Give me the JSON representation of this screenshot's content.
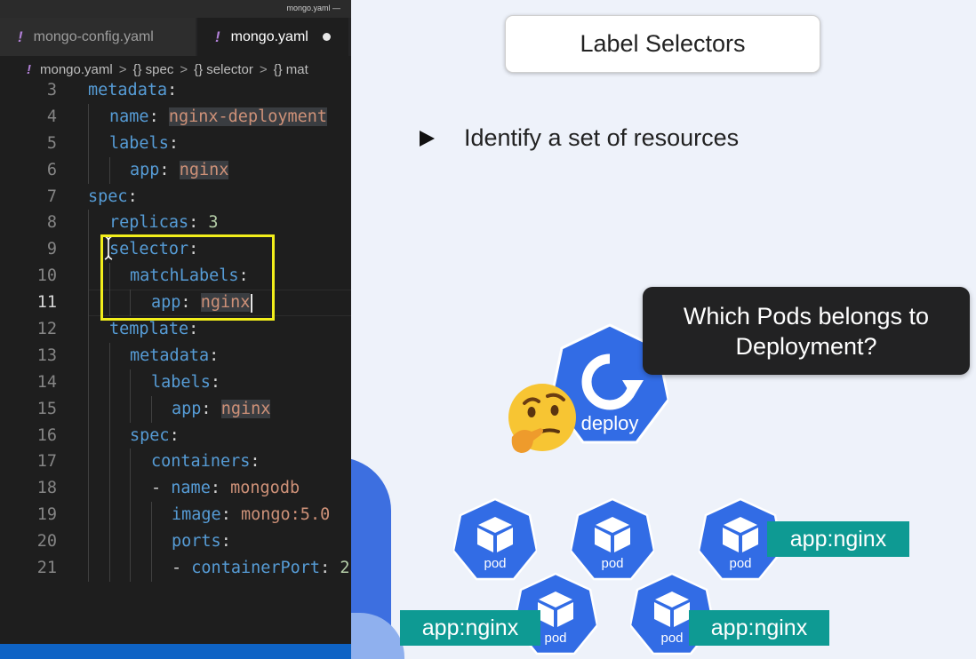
{
  "editor": {
    "window_title": "mongo.yaml —",
    "tabs": [
      {
        "icon": "!",
        "label": "mongo-config.yaml"
      },
      {
        "icon": "!",
        "label": "mongo.yaml"
      }
    ],
    "breadcrumb": {
      "file_icon": "!",
      "file": "mongo.yaml",
      "separator": ">",
      "items": [
        "{} spec",
        "{} selector",
        "{} mat"
      ]
    },
    "active_line": "11",
    "lines": [
      {
        "n": "3"
      },
      {
        "n": "4"
      },
      {
        "n": "5"
      },
      {
        "n": "6"
      },
      {
        "n": "7"
      },
      {
        "n": "8"
      },
      {
        "n": "9"
      },
      {
        "n": "10"
      },
      {
        "n": "11"
      },
      {
        "n": "12"
      },
      {
        "n": "13"
      },
      {
        "n": "14"
      },
      {
        "n": "15"
      },
      {
        "n": "16"
      },
      {
        "n": "17"
      },
      {
        "n": "18"
      },
      {
        "n": "19"
      },
      {
        "n": "20"
      },
      {
        "n": "21"
      }
    ],
    "code": {
      "metadata": "metadata",
      "name": "name",
      "nginx_deployment": "nginx-deployment",
      "labels": "labels",
      "app": "app",
      "nginx": "nginx",
      "spec": "spec",
      "replicas": "replicas",
      "three": "3",
      "selector": "selector",
      "matchLabels": "matchLabels",
      "template": "template",
      "containers": "containers",
      "mongodb": "mongodb",
      "image": "image",
      "mongo_image": "mongo:5.0",
      "ports": "ports",
      "containerPort": "containerPort",
      "colon": ":",
      "dash": "-",
      "trunc": "2"
    }
  },
  "slide": {
    "title": "Label Selectors",
    "bullet": "Identify a set of resources",
    "callout_line1": "Which Pods belongs to",
    "callout_line2": "Deployment?",
    "deploy_label": "deploy",
    "pod_label": "pod",
    "tag_label": "app:nginx",
    "colors": {
      "kube_blue": "#326ce5",
      "tag_teal": "#0e9a93",
      "highlight_yellow": "#f2ee1b"
    }
  }
}
